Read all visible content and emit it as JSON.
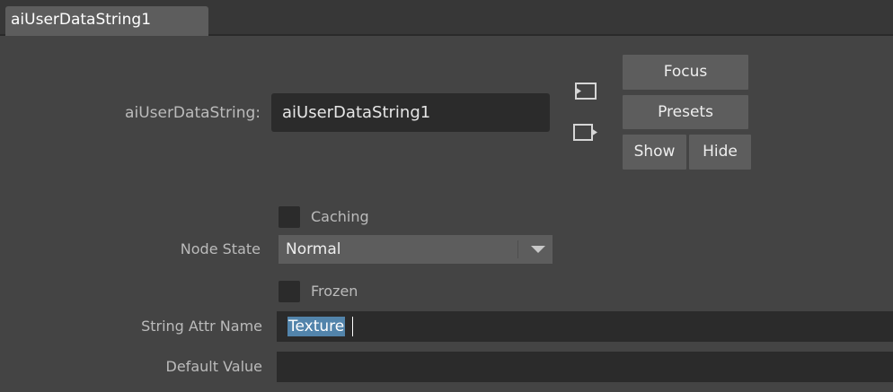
{
  "tab": {
    "label": "aiUserDataString1"
  },
  "node": {
    "type_label": "aiUserDataString:",
    "name_value": "aiUserDataString1"
  },
  "buttons": {
    "focus": "Focus",
    "presets": "Presets",
    "show": "Show",
    "hide": "Hide"
  },
  "caching": {
    "label": "Caching",
    "checked": false
  },
  "node_state": {
    "label": "Node State",
    "value": "Normal"
  },
  "frozen": {
    "label": "Frozen",
    "checked": false
  },
  "string_attr": {
    "label": "String Attr Name",
    "value": "Texture"
  },
  "default_value": {
    "label": "Default Value",
    "value": ""
  },
  "icons": {
    "input_connection": "input-connection-icon",
    "output_connection": "output-connection-icon",
    "dropdown": "chevron-down-icon"
  },
  "colors": {
    "background": "#444444",
    "field": "#2b2b2b",
    "button": "#5d5d5d",
    "selection": "#5284ab"
  }
}
